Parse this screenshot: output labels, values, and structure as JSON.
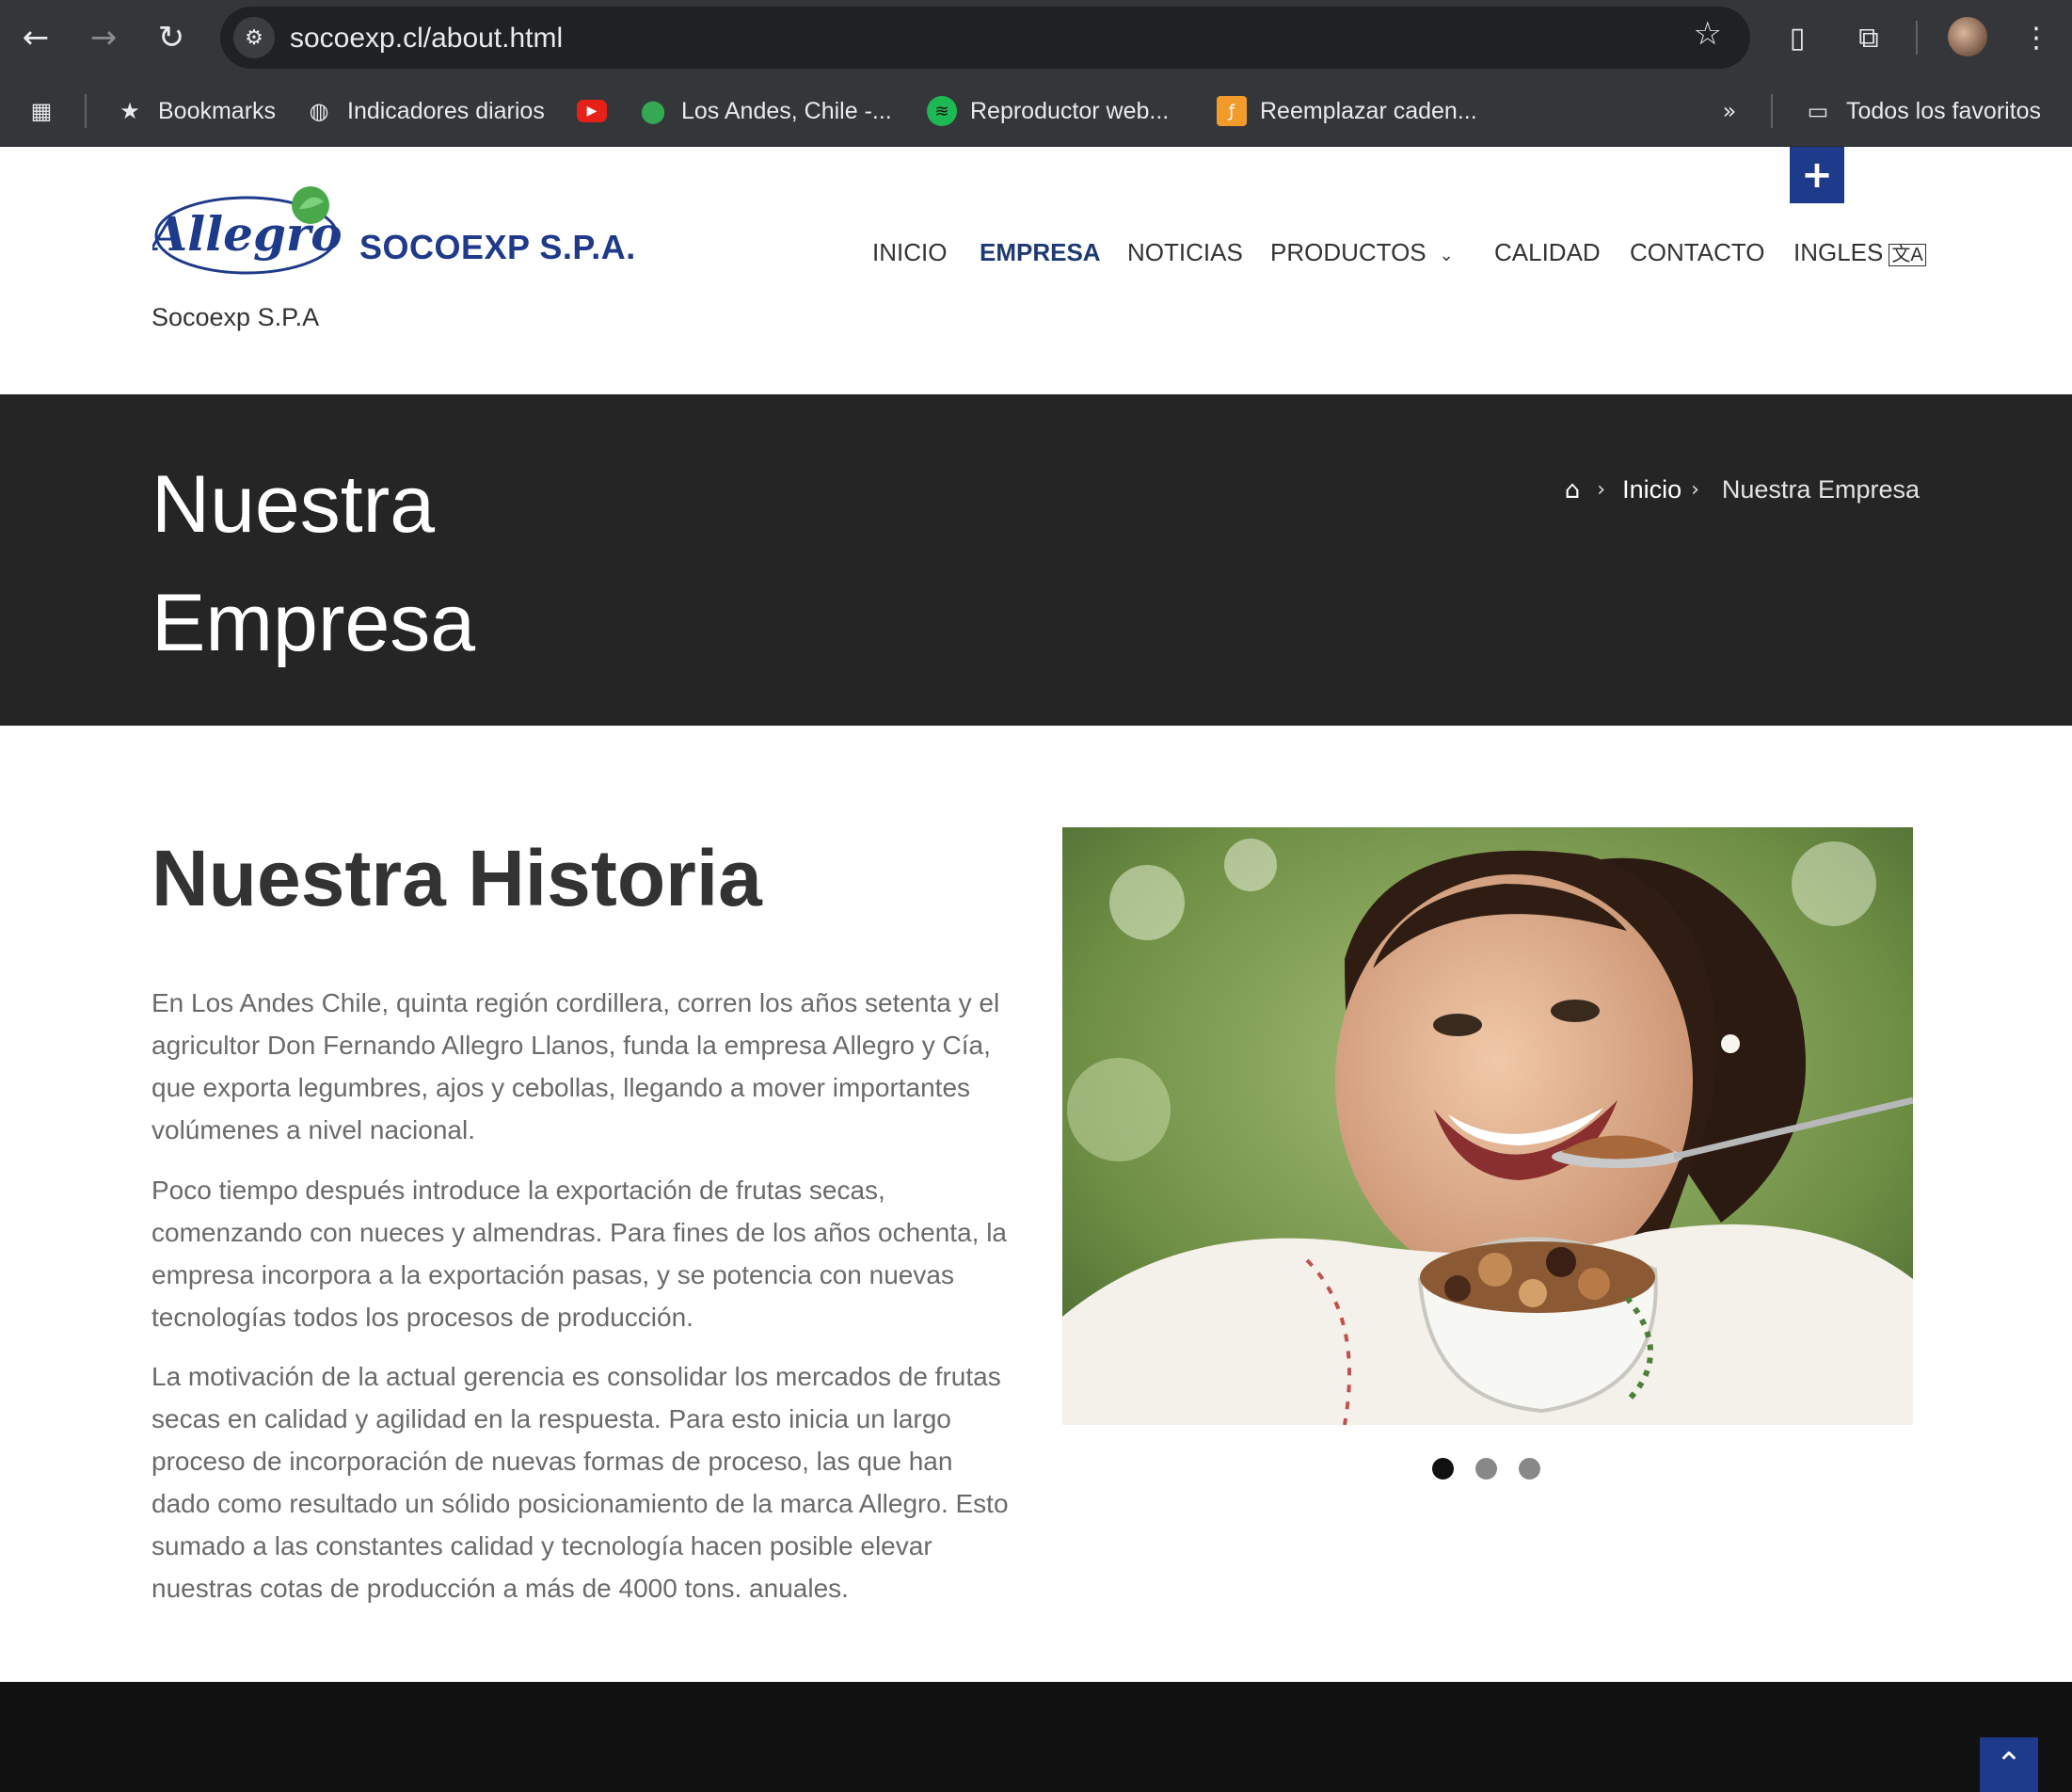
{
  "browser": {
    "url": "socoexp.cl/about.html",
    "bookmarks": [
      {
        "label": "Bookmarks",
        "icon": "star-icon"
      },
      {
        "label": "Indicadores diarios",
        "icon": "globe-icon"
      },
      {
        "label": "",
        "icon": "youtube-icon"
      },
      {
        "label": "Los Andes, Chile -...",
        "icon": "maps-pin-icon"
      },
      {
        "label": "Reproductor web...",
        "icon": "spotify-icon"
      },
      {
        "label": "Reemplazar caden...",
        "icon": "app-icon"
      }
    ],
    "all_bookmarks_label": "Todos los favoritos"
  },
  "site": {
    "logo_text": "SOCOEXP S.P.A.",
    "logo_script": "Allegro",
    "tagline": "Socoexp S.P.A",
    "brand_color": "#1e3a8a"
  },
  "nav": {
    "items": [
      {
        "label": "INICIO"
      },
      {
        "label": "EMPRESA",
        "active": true
      },
      {
        "label": "NOTICIAS"
      },
      {
        "label": "PRODUCTOS"
      },
      {
        "label": "CALIDAD"
      },
      {
        "label": "CONTACTO"
      },
      {
        "label": "INGLES"
      }
    ]
  },
  "title_bar": {
    "title": "Nuestra Empresa",
    "breadcrumb": {
      "home_icon": "home-icon",
      "inicio": "Inicio",
      "current": "Nuestra Empresa"
    }
  },
  "history": {
    "heading_light": "Nuestra",
    "heading_bold": "Historia",
    "paragraphs": [
      "En Los Andes Chile, quinta región cordillera, corren los años setenta y el agricultor Don Fernando Allegro Llanos, funda la empresa Allegro y Cía, que exporta legumbres, ajos y cebollas, llegando a mover importantes volúmenes a nivel nacional.",
      "Poco tiempo después introduce la exportación de frutas secas, comenzando con nueces y almendras. Para fines de los años ochenta, la empresa incorpora a la exportación pasas, y se potencia con nuevas tecnologías todos los procesos de producción.",
      "La motivación de la actual gerencia es consolidar los mercados de frutas secas en calidad y agilidad en la respuesta. Para esto inicia un largo proceso de incorporación de nuevas formas de proceso, las que han dado como resultado un sólido posicionamiento de la marca Allegro. Esto sumado a las constantes calidad y tecnología hacen posible elevar nuestras cotas de producción a más de 4000 tons. anuales."
    ]
  },
  "carousel": {
    "slide_count": 3,
    "active_index": 0
  }
}
